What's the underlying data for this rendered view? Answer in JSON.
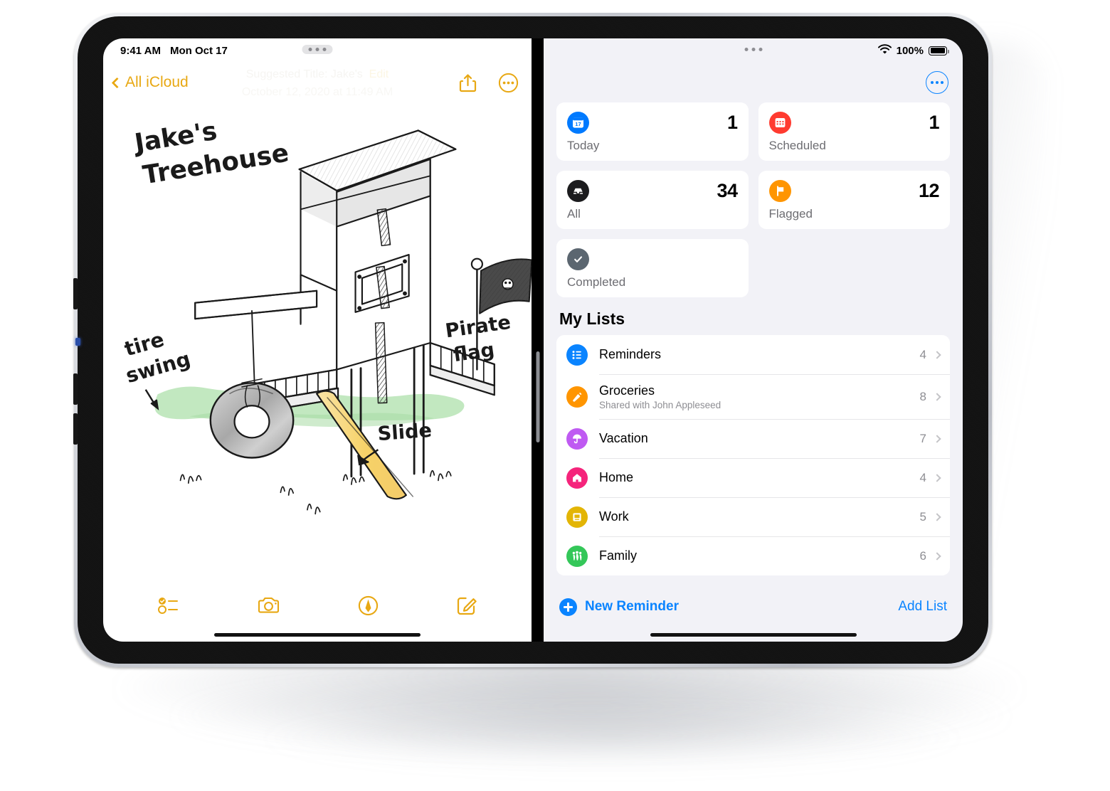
{
  "status_bar": {
    "time": "9:41 AM",
    "date": "Mon Oct 17",
    "battery_percent": "100%"
  },
  "notes_app": {
    "back_label": "All iCloud",
    "suggested_title": "Suggested Title: Jake's",
    "edit_label": "Edit",
    "date_line": "October 12, 2020 at 11:49 AM",
    "sketch": {
      "title_line1": "Jake's",
      "title_line2": "Treehouse",
      "label_tire_swing_line1": "tire",
      "label_tire_swing_line2": "swing",
      "label_pirate_line1": "Pirate",
      "label_pirate_line2": "flag",
      "label_slide": "Slide",
      "slide_color": "#f7d88a",
      "grass_color": "#b6e3b6"
    },
    "accent_color": "#e8a813",
    "toolbar": [
      {
        "name": "checklist-icon",
        "label": "Checklist"
      },
      {
        "name": "camera-icon",
        "label": "Camera"
      },
      {
        "name": "markup-pen-icon",
        "label": "Markup"
      },
      {
        "name": "compose-icon",
        "label": "Compose"
      }
    ]
  },
  "reminders_app": {
    "accent_color": "#0a84ff",
    "smart_lists": [
      {
        "label": "Today",
        "count": "1",
        "icon": "calendar-day-icon",
        "color": "#007aff"
      },
      {
        "label": "Scheduled",
        "count": "1",
        "icon": "calendar-icon",
        "color": "#ff3b30"
      },
      {
        "label": "All",
        "count": "34",
        "icon": "inbox-icon",
        "color": "#1c1c1e"
      },
      {
        "label": "Flagged",
        "count": "12",
        "icon": "flag-icon",
        "color": "#ff9500"
      },
      {
        "label": "Completed",
        "count": "",
        "icon": "checkmark-circle-icon",
        "color": "#5b6670"
      }
    ],
    "my_lists_heading": "My Lists",
    "lists": [
      {
        "name": "Reminders",
        "subtitle": "",
        "count": "4",
        "icon": "list-bullet-icon",
        "color": "#0a84ff"
      },
      {
        "name": "Groceries",
        "subtitle": "Shared with John Appleseed",
        "count": "8",
        "icon": "carrot-icon",
        "color": "#ff9500"
      },
      {
        "name": "Vacation",
        "subtitle": "",
        "count": "7",
        "icon": "umbrella-icon",
        "color": "#bf5af2"
      },
      {
        "name": "Home",
        "subtitle": "",
        "count": "4",
        "icon": "house-icon",
        "color": "#f5247b"
      },
      {
        "name": "Work",
        "subtitle": "",
        "count": "5",
        "icon": "desktop-icon",
        "color": "#e3b505"
      },
      {
        "name": "Family",
        "subtitle": "",
        "count": "6",
        "icon": "family-icon",
        "color": "#34c759"
      }
    ],
    "new_reminder_label": "New Reminder",
    "add_list_label": "Add List"
  }
}
